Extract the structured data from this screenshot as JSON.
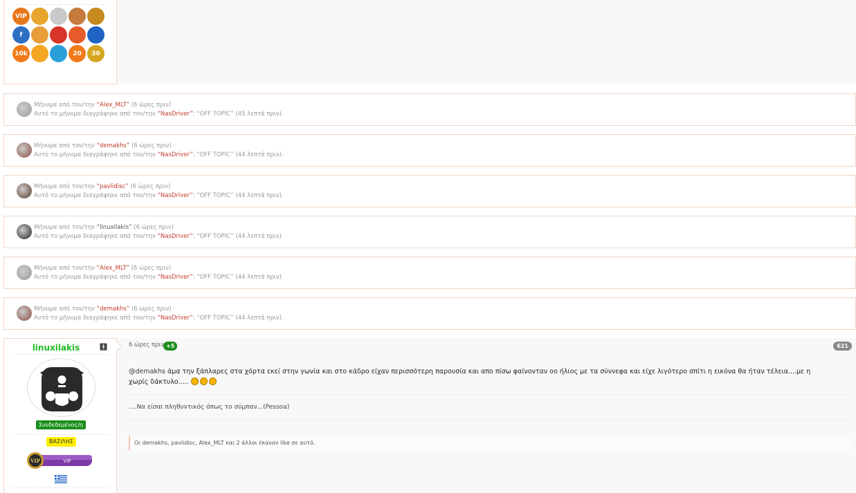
{
  "deleted_messages": [
    {
      "prefix": "Μήνυμα από τον/την",
      "user": "“Alex_MLT”",
      "ago": "(6 ώρες πριν)",
      "deleted_prefix": "Αυτό το μήνυμα διαγράφηκε από τον/την",
      "moderator": "“NasDriver”",
      "reason": ": “OFF TOPIC” (45 λεπτά πριν)."
    },
    {
      "prefix": "Μήνυμα από τον/την",
      "user": "“demakhs”",
      "ago": "(6 ώρες πριν)",
      "deleted_prefix": "Αυτό το μήνυμα διαγράφηκε από τον/την",
      "moderator": "“NasDriver”",
      "reason": ": “OFF TOPIC” (44 λεπτά πριν)."
    },
    {
      "prefix": "Μήνυμα από τον/την",
      "user": "“pavlidisc”",
      "ago": "(6 ώρες πριν)",
      "deleted_prefix": "Αυτό το μήνυμα διαγράφηκε από τον/την",
      "moderator": "“NasDriver”",
      "reason": ": “OFF TOPIC” (44 λεπτά πριν)."
    },
    {
      "prefix": "Μήνυμα από τον/την",
      "user": "“linuxilakis”",
      "ago": "(6 ώρες πριν)",
      "deleted_prefix": "Αυτό το μήνυμα διαγράφηκε από τον/την",
      "moderator": "“NasDriver”",
      "reason": ": “OFF TOPIC” (44 λεπτά πριν)."
    },
    {
      "prefix": "Μήνυμα από τον/την",
      "user": "“Alex_MLT”",
      "ago": "(6 ώρες πριν)",
      "deleted_prefix": "Αυτό το μήνυμα διαγράφηκε από τον/την",
      "moderator": "“NasDriver”",
      "reason": ": “OFF TOPIC” (44 λεπτά πριν)."
    },
    {
      "prefix": "Μήνυμα από τον/την",
      "user": "“demakhs”",
      "ago": "(6 ώρες πριν)",
      "deleted_prefix": "Αυτό το μήνυμα διαγράφηκε από τον/την",
      "moderator": "“NasDriver”",
      "reason": ": “OFF TOPIC” (44 λεπτά πριν)."
    }
  ],
  "awards": [
    {
      "icon": "vip-award-icon",
      "label": "VIP",
      "color": "#e8761a"
    },
    {
      "icon": "gold-ribbon-icon",
      "label": "",
      "color": "#e7a52b"
    },
    {
      "icon": "silver-medal-icon",
      "label": "",
      "color": "#c9c9c9"
    },
    {
      "icon": "bronze-medal-icon",
      "label": "",
      "color": "#c47b3b"
    },
    {
      "icon": "book-icon",
      "label": "",
      "color": "#c68a1e"
    },
    {
      "icon": "facebook-icon",
      "label": "f",
      "color": "#2d6fc4"
    },
    {
      "icon": "notepad-icon",
      "label": "",
      "color": "#e89c3a"
    },
    {
      "icon": "fire-icon",
      "label": "",
      "color": "#d8352a"
    },
    {
      "icon": "gift-icon",
      "label": "",
      "color": "#e75a2a"
    },
    {
      "icon": "greek-flag-icon",
      "label": "",
      "color": "#1f63c4"
    },
    {
      "icon": "10k-icon",
      "label": "10k",
      "color": "#f07a1a"
    },
    {
      "icon": "thumbs-up-icon",
      "label": "",
      "color": "#f5a623"
    },
    {
      "icon": "chat-bubbles-icon",
      "label": "",
      "color": "#2a9fd8"
    },
    {
      "icon": "20-years-icon",
      "label": "20",
      "color": "#f07a1a"
    },
    {
      "icon": "30-years-icon",
      "label": "30",
      "color": "#d6a520"
    }
  ],
  "post": {
    "username": "linuxilakis",
    "status": "Συνδεδεμένος/η",
    "rank": "ΒΑΣΙΛΗΣ",
    "vip_label": "VIP",
    "time": "6 ώρες πριν",
    "reputation": "+5",
    "number": "621",
    "mention": "@demakhs",
    "body": " άμα την ξάπλαρες στα χόρτα εκεί στην γωνία και στο κάδρο είχαν περισσότερη παρουσία και απο πίσω φαίνονταν οο ήλιος με τα σύννεφα και είχε λιγότερο σπίτι η εικόνα θα ήταν τέλεια....με η χωρίς δάκτυλο.....",
    "signature": "....Να είσαι πληθυντικός όπως το σύμπαν...(Pessoa)",
    "likes": "Οι demakhs, pavlidisc, Alex_MLT και 2 άλλοι έκαναν like σε αυτό."
  }
}
